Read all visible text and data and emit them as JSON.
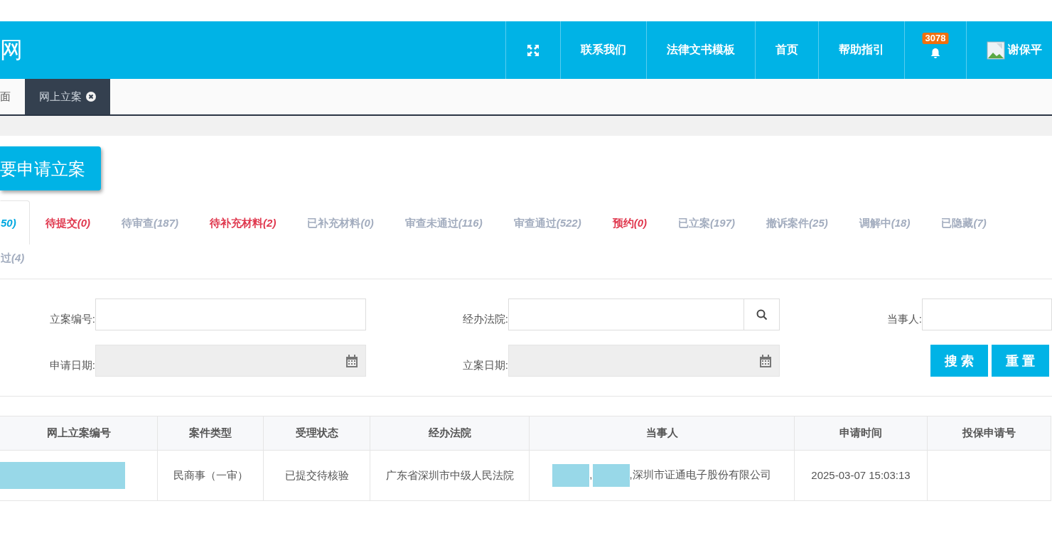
{
  "header": {
    "logo": "网",
    "nav": [
      {
        "kind": "fullscreen"
      },
      {
        "kind": "link",
        "label": "联系我们"
      },
      {
        "kind": "link",
        "label": "法律文书模板"
      },
      {
        "kind": "link",
        "label": "首页"
      },
      {
        "kind": "link",
        "label": "帮助指引"
      },
      {
        "kind": "bell",
        "badge": "3078"
      },
      {
        "kind": "user",
        "label": "谢保平"
      }
    ]
  },
  "page_tabs": [
    {
      "label": "面",
      "selected": false,
      "closable": false
    },
    {
      "label": "网上立案",
      "selected": true,
      "closable": true
    }
  ],
  "apply_button": "要申请立案",
  "status_tabs": [
    {
      "count": "50)",
      "color": "#00a8e0",
      "selected": true
    },
    {
      "label": "待提交",
      "count": "(0)",
      "color": "#e0394f",
      "selected": false
    },
    {
      "label": "待审查",
      "count": "(187)",
      "color": "#a3adbf",
      "selected": false
    },
    {
      "label": "待补充材料",
      "count": "(2)",
      "color": "#e0394f",
      "selected": false
    },
    {
      "label": "已补充材料",
      "count": "(0)",
      "color": "#a3adbf",
      "selected": false
    },
    {
      "label": "审查未通过",
      "count": "(116)",
      "color": "#a3adbf",
      "selected": false
    },
    {
      "label": "审查通过",
      "count": "(522)",
      "color": "#a3adbf",
      "selected": false
    },
    {
      "label": "预约",
      "count": "(0)",
      "color": "#e0394f",
      "selected": false
    },
    {
      "label": "已立案",
      "count": "(197)",
      "color": "#a3adbf",
      "selected": false
    },
    {
      "label": "撤诉案件",
      "count": "(25)",
      "color": "#a3adbf",
      "selected": false
    },
    {
      "label": "调解中",
      "count": "(18)",
      "color": "#a3adbf",
      "selected": false
    },
    {
      "label": "已隐藏",
      "count": "(7)",
      "color": "#a3adbf",
      "selected": false
    },
    {
      "label": "过",
      "count": "(4)",
      "color": "#a3adbf",
      "selected": false
    }
  ],
  "filters": [
    {
      "label": "立案编号:",
      "kind": "text"
    },
    {
      "label": "经办法院:",
      "kind": "search"
    },
    {
      "label": "当事人:",
      "kind": "text"
    },
    {
      "label": "申请日期:",
      "kind": "date"
    },
    {
      "label": "立案日期:",
      "kind": "date"
    }
  ],
  "filter_buttons": [
    "搜 索",
    "重 置"
  ],
  "table": {
    "columns": [
      "网上立案编号",
      "案件类型",
      "受理状态",
      "经办法院",
      "当事人",
      "申请时间",
      "投保申请号"
    ],
    "rows": [
      {
        "cells": [
          [
            {
              "kind": "redacted"
            }
          ],
          [
            {
              "kind": "text",
              "text": "民商事（一审）"
            }
          ],
          [
            {
              "kind": "text",
              "text": "已提交待核验"
            }
          ],
          [
            {
              "kind": "text",
              "text": "广东省深圳市中级人民法院"
            }
          ],
          [
            {
              "kind": "redacted"
            },
            {
              "kind": "text",
              "text": ","
            },
            {
              "kind": "redacted"
            },
            {
              "kind": "text",
              "text": ",深圳市证通电子股份有限公司"
            }
          ],
          [
            {
              "kind": "text",
              "text": "2025-03-07 15:03:13"
            }
          ],
          []
        ]
      }
    ]
  }
}
